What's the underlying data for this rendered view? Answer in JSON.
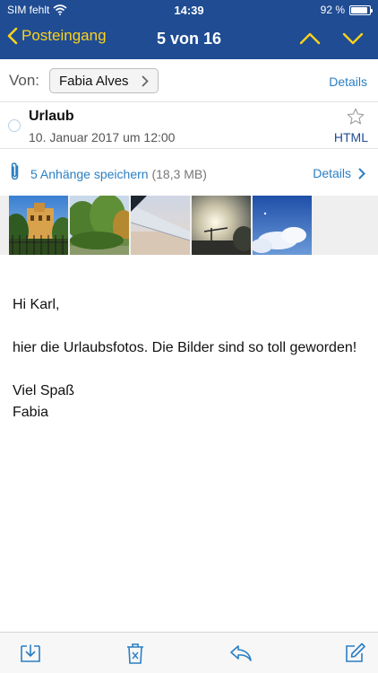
{
  "status_bar": {
    "carrier": "SIM fehlt",
    "time": "14:39",
    "battery_text": "92 %",
    "battery_level": 0.92
  },
  "nav": {
    "back_label": "Posteingang",
    "title": "5 von 16"
  },
  "header": {
    "from_label": "Von:",
    "sender": "Fabia Alves",
    "details_label": "Details",
    "subject": "Urlaub",
    "date": "10. Januar 2017 um 12:00",
    "format_label": "HTML"
  },
  "attachments": {
    "save_label": "5 Anhänge speichern",
    "size": "(18,3 MB)",
    "details_label": "Details",
    "thumbnails": [
      "villa",
      "trees",
      "airplane-wing",
      "sunset-crane",
      "blue-sky"
    ]
  },
  "message": {
    "greeting": "Hi Karl,",
    "line1": "hier die Urlaubsfotos. Die Bilder sind so toll geworden!",
    "closing": "Viel Spaß",
    "signature": "Fabia"
  },
  "colors": {
    "nav_bg": "#1f4c93",
    "accent_yellow": "#ffd21a",
    "link_blue": "#2a7fc4"
  },
  "toolbar": {
    "icons": [
      "archive-icon",
      "trash-icon",
      "reply-icon",
      "compose-icon"
    ]
  }
}
